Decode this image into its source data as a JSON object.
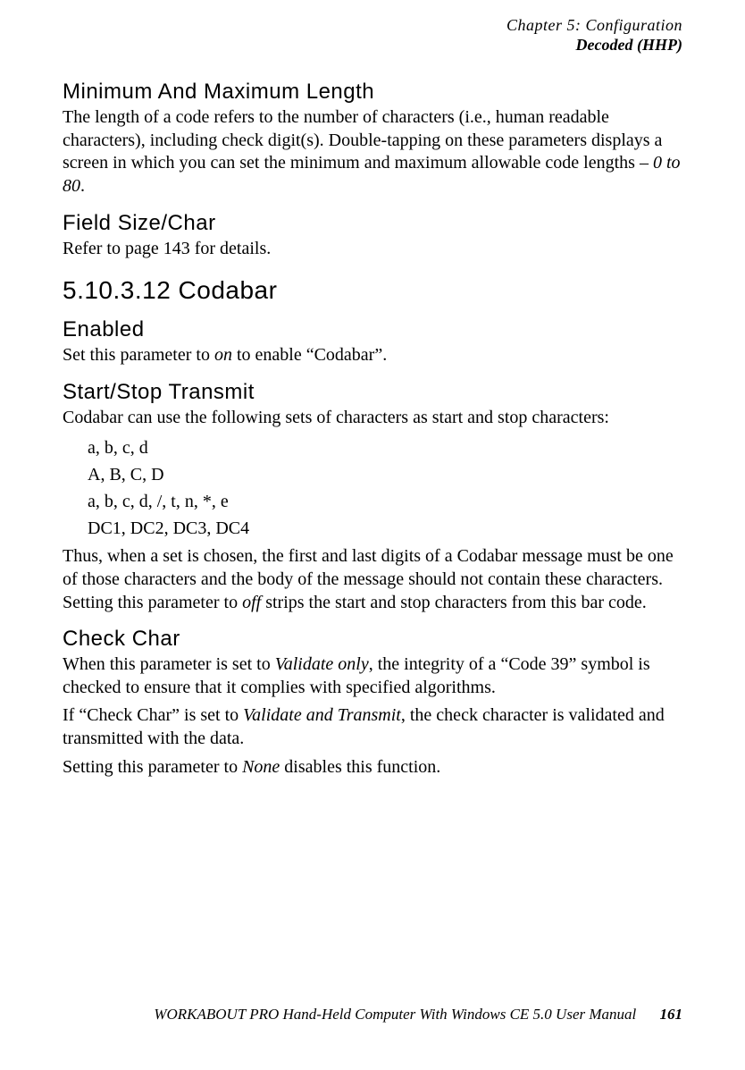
{
  "header": {
    "line1": "Chapter  5:  Configuration",
    "line2": "Decoded (HHP)"
  },
  "s1": {
    "title": "Minimum  And  Maximum  Length",
    "p1a": "The length of a code refers to the number of characters (i.e., human readable characters), including check digit(s). Double-tapping on these parameters displays a screen in which you can set the minimum and maximum allowable code lengths – ",
    "p1b": "0 to 80",
    "p1c": "."
  },
  "s2": {
    "title": "Field  Size/Char",
    "p1": "Refer to page 143 for details."
  },
  "s3": {
    "title": "5.10.3.12   Codabar"
  },
  "s4": {
    "title": "Enabled",
    "p1a": "Set this parameter to ",
    "p1b": "on",
    "p1c": " to enable “Codabar”."
  },
  "s5": {
    "title": "Start/Stop  Transmit",
    "p1": "Codabar can use the following sets of characters as start and stop characters:",
    "list": {
      "i1": "a, b, c, d",
      "i2": "A, B, C, D",
      "i3": "a, b, c, d, /, t, n, *, e",
      "i4": "DC1, DC2, DC3, DC4"
    },
    "p2a": "Thus, when a set is chosen, the first and last digits of a Codabar message must be one of those characters and the body of the message should not contain these characters. Setting this parameter to ",
    "p2b": "off",
    "p2c": " strips the start and stop characters from this bar code."
  },
  "s6": {
    "title": "Check  Char",
    "p1a": "When this parameter is set to ",
    "p1b": "Validate only",
    "p1c": ", the integrity of a “Code 39” symbol is checked to ensure that it complies with specified algorithms.",
    "p2a": "If “Check Char” is set to ",
    "p2b": "Validate and Transmit",
    "p2c": ", the check character is validated and transmitted with the data.",
    "p3a": "Setting this parameter to ",
    "p3b": "None",
    "p3c": " disables this function."
  },
  "footer": {
    "text": "WORKABOUT PRO Hand-Held Computer With Windows CE 5.0 User Manual",
    "page": "161"
  }
}
